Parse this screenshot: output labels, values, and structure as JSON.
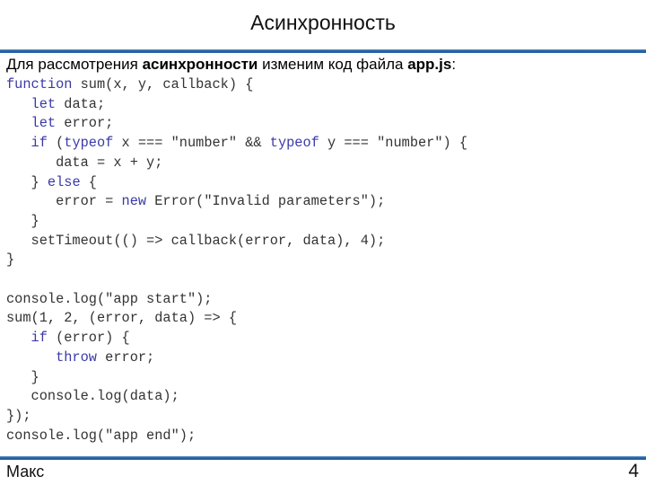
{
  "slide": {
    "title": "Асинхронность",
    "intro": {
      "part1": "Для рассмотрения ",
      "bold1": "асинхронности",
      "part2": " изменим код файла ",
      "bold2": "app.js",
      "part3": ":"
    },
    "code_lines": [
      [
        {
          "t": "function",
          "k": 1
        },
        {
          "t": " sum(x, y, callback) {"
        }
      ],
      [
        {
          "t": "   "
        },
        {
          "t": "let",
          "k": 1
        },
        {
          "t": " data;"
        }
      ],
      [
        {
          "t": "   "
        },
        {
          "t": "let",
          "k": 1
        },
        {
          "t": " error;"
        }
      ],
      [
        {
          "t": "   "
        },
        {
          "t": "if",
          "k": 1
        },
        {
          "t": " ("
        },
        {
          "t": "typeof",
          "k": 1
        },
        {
          "t": " x === \"number\" && "
        },
        {
          "t": "typeof",
          "k": 1
        },
        {
          "t": " y === \"number\") {"
        }
      ],
      [
        {
          "t": "      data = x + y;"
        }
      ],
      [
        {
          "t": "   } "
        },
        {
          "t": "else",
          "k": 1
        },
        {
          "t": " {"
        }
      ],
      [
        {
          "t": "      error = "
        },
        {
          "t": "new",
          "k": 1
        },
        {
          "t": " Error(\"Invalid parameters\");"
        }
      ],
      [
        {
          "t": "   }"
        }
      ],
      [
        {
          "t": "   setTimeout(() => callback(error, data), 4);"
        }
      ],
      [
        {
          "t": "}"
        }
      ],
      [
        {
          "t": ""
        }
      ],
      [
        {
          "t": "console.log(\"app start\");"
        }
      ],
      [
        {
          "t": "sum(1, 2, (error, data) => {"
        }
      ],
      [
        {
          "t": "   "
        },
        {
          "t": "if",
          "k": 1
        },
        {
          "t": " (error) {"
        }
      ],
      [
        {
          "t": "      "
        },
        {
          "t": "throw",
          "k": 1
        },
        {
          "t": " error;"
        }
      ],
      [
        {
          "t": "   }"
        }
      ],
      [
        {
          "t": "   console.log(data);"
        }
      ],
      [
        {
          "t": "});"
        }
      ],
      [
        {
          "t": "console.log(\"app end\");"
        }
      ]
    ],
    "footer": {
      "author": "Макс",
      "page_number": "4"
    },
    "colors": {
      "keyword": "#3a3aa8",
      "code_text": "#333333",
      "rule": "#1f5e9c"
    }
  }
}
